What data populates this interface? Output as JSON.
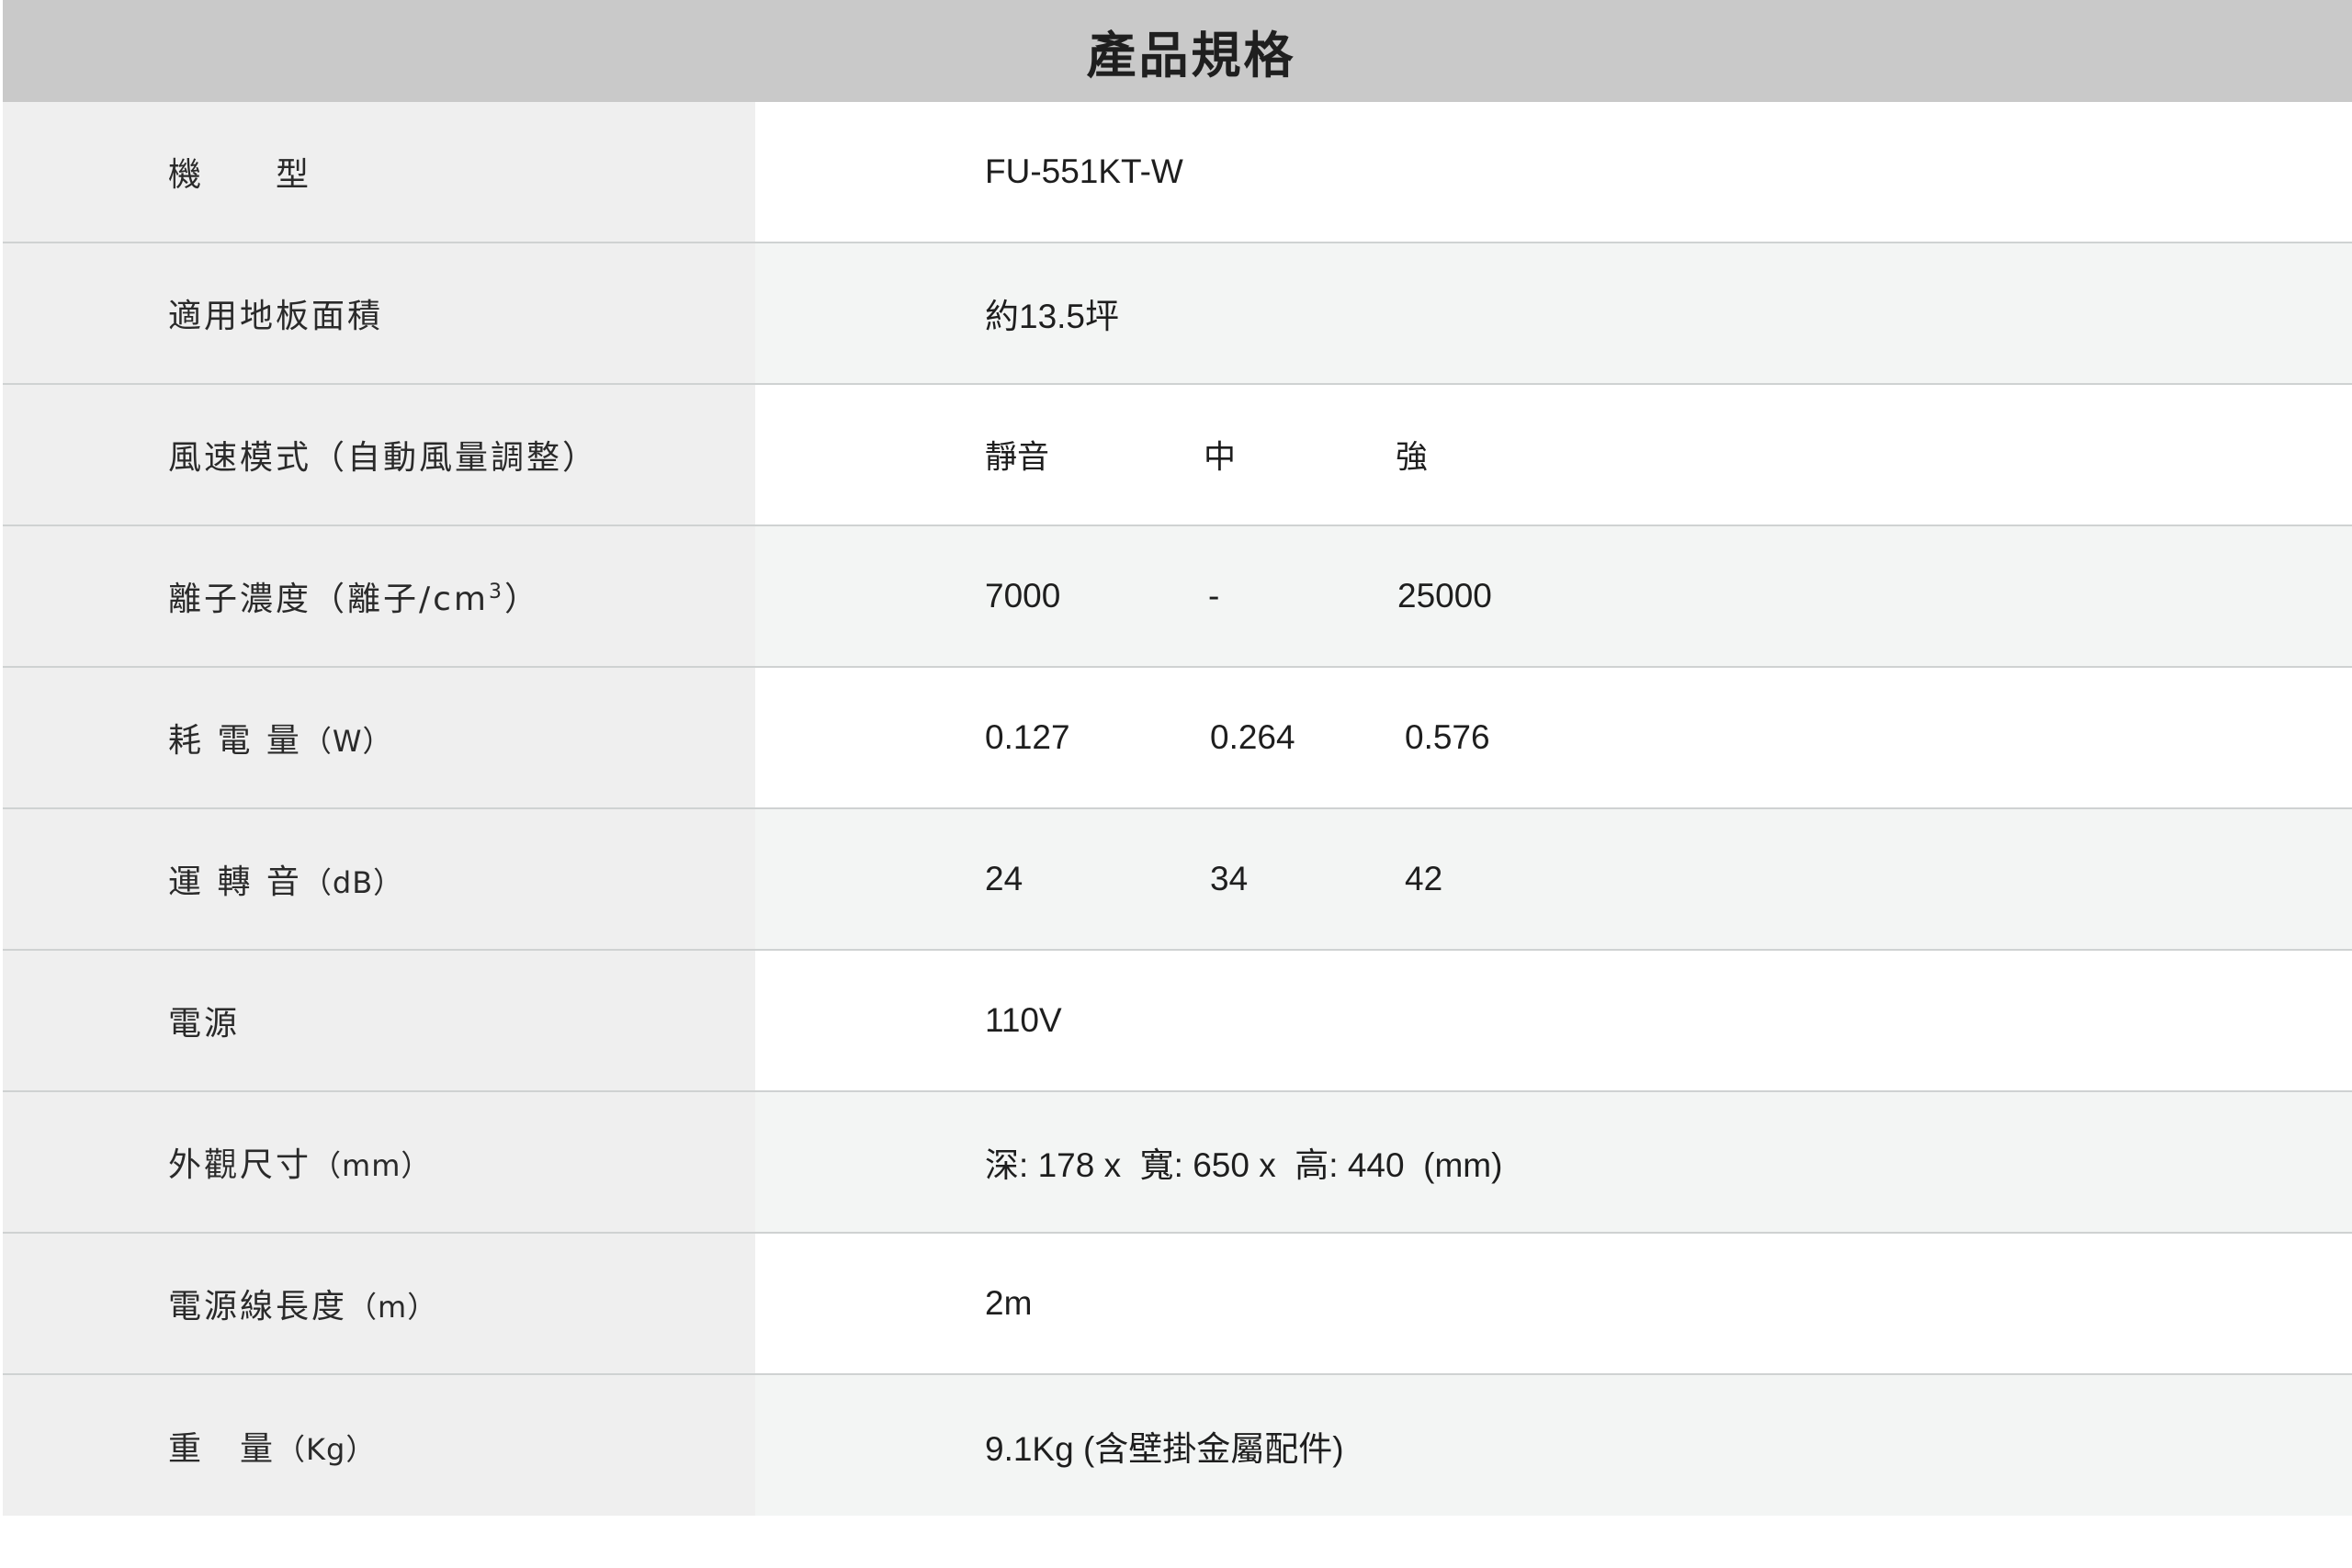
{
  "title": "產品規格",
  "rows": [
    {
      "label": "機　　型",
      "v1": "FU-551KT-W"
    },
    {
      "label": "適用地板面積",
      "v1_prefix": "約",
      "v1": "13.5",
      "v1_suffix": "坪"
    },
    {
      "label": "風速模式（自動風量調整）",
      "v1": "靜音",
      "v2": "中",
      "v3": "強"
    },
    {
      "label": "離子濃度（離子/cm",
      "label_sup": "3",
      "label_close": "）",
      "v1": "7000",
      "v2": "-",
      "v3": "25000"
    },
    {
      "label": "耗 電 量",
      "label_unit": "（W）",
      "v1": "0.127",
      "v2": "0.264",
      "v3": "0.576"
    },
    {
      "label": "運 轉 音",
      "label_unit": "（dB）",
      "v1": "24",
      "v2": "34",
      "v3": "42"
    },
    {
      "label": "電源",
      "v1": "110V"
    },
    {
      "label": "外觀尺寸",
      "label_unit": "（mm）",
      "d_label": "深:",
      "d_val": "178 x",
      "w_label": "寬:",
      "w_val": "650 x",
      "h_label": "高:",
      "h_val": "440",
      "dim_unit": "(mm)"
    },
    {
      "label": "電源線長度",
      "label_unit": "（m）",
      "v1": "2m"
    },
    {
      "label": "重　量",
      "label_unit": "（Kg）",
      "v1": "9.1Kg",
      "v1_note": "(含壁掛金屬配件)"
    }
  ]
}
